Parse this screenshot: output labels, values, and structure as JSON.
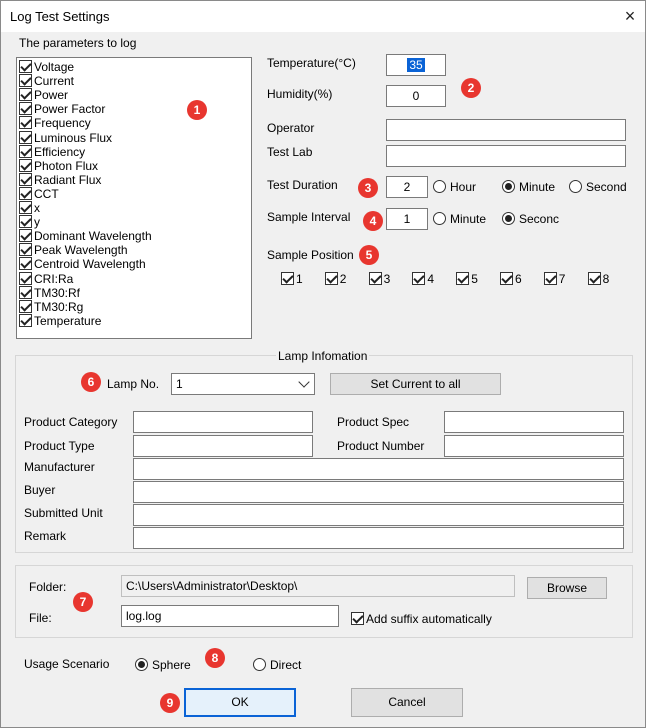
{
  "window": {
    "title": "Log Test Settings",
    "close_icon": "×"
  },
  "params": {
    "heading": "The parameters to log",
    "items": [
      {
        "label": "Voltage",
        "checked": true
      },
      {
        "label": "Current",
        "checked": true
      },
      {
        "label": "Power",
        "checked": true
      },
      {
        "label": "Power Factor",
        "checked": true
      },
      {
        "label": "Frequency",
        "checked": true
      },
      {
        "label": "Luminous Flux",
        "checked": true
      },
      {
        "label": "Efficiency",
        "checked": true
      },
      {
        "label": "Photon Flux",
        "checked": true
      },
      {
        "label": "Radiant Flux",
        "checked": true
      },
      {
        "label": "CCT",
        "checked": true
      },
      {
        "label": "x",
        "checked": true
      },
      {
        "label": "y",
        "checked": true
      },
      {
        "label": "Dominant Wavelength",
        "checked": true
      },
      {
        "label": "Peak Wavelength",
        "checked": true
      },
      {
        "label": "Centroid Wavelength",
        "checked": true
      },
      {
        "label": "CRI:Ra",
        "checked": true
      },
      {
        "label": "TM30:Rf",
        "checked": true
      },
      {
        "label": "TM30:Rg",
        "checked": true
      },
      {
        "label": "Temperature",
        "checked": true
      }
    ]
  },
  "env": {
    "temperature_label": "Temperature(°C)",
    "temperature_value": "35",
    "humidity_label": "Humidity(%)",
    "humidity_value": "0",
    "operator_label": "Operator",
    "operator_value": "",
    "testlab_label": "Test Lab",
    "testlab_value": ""
  },
  "duration": {
    "label": "Test Duration",
    "value": "2",
    "options": [
      "Hour",
      "Minute",
      "Second"
    ],
    "selected": "Minute"
  },
  "interval": {
    "label": "Sample Interval",
    "value": "1",
    "options": [
      "Minute",
      "Seconc"
    ],
    "selected": "Seconc"
  },
  "positions": {
    "label": "Sample Position",
    "items": [
      {
        "label": "1",
        "checked": true
      },
      {
        "label": "2",
        "checked": true
      },
      {
        "label": "3",
        "checked": true
      },
      {
        "label": "4",
        "checked": true
      },
      {
        "label": "5",
        "checked": true
      },
      {
        "label": "6",
        "checked": true
      },
      {
        "label": "7",
        "checked": true
      },
      {
        "label": "8",
        "checked": true
      }
    ]
  },
  "lamp": {
    "group_title": "Lamp Infomation",
    "lamp_no_label": "Lamp No.",
    "lamp_no_value": "1",
    "set_current_button": "Set Current to all",
    "fields": {
      "product_category": "Product Category",
      "product_spec": "Product Spec",
      "product_type": "Product Type",
      "product_number": "Product Number",
      "manufacturer": "Manufacturer",
      "buyer": "Buyer",
      "submitted_unit": "Submitted Unit",
      "remark": "Remark"
    }
  },
  "output": {
    "folder_label": "Folder:",
    "folder_value": "C:\\Users\\Administrator\\Desktop\\",
    "browse_button": "Browse",
    "file_label": "File:",
    "file_value": "log.log",
    "suffix_label": "Add suffix automatically",
    "suffix_checked": true
  },
  "usage": {
    "label": "Usage Scenario",
    "options": [
      "Sphere",
      "Direct"
    ],
    "selected": "Sphere"
  },
  "actions": {
    "ok": "OK",
    "cancel": "Cancel"
  },
  "badges": [
    "1",
    "2",
    "3",
    "4",
    "5",
    "6",
    "7",
    "8",
    "9"
  ],
  "colors": {
    "badge": "#e8362f",
    "focus": "#0a63d6",
    "dialog_bg": "#f0f0f0"
  }
}
